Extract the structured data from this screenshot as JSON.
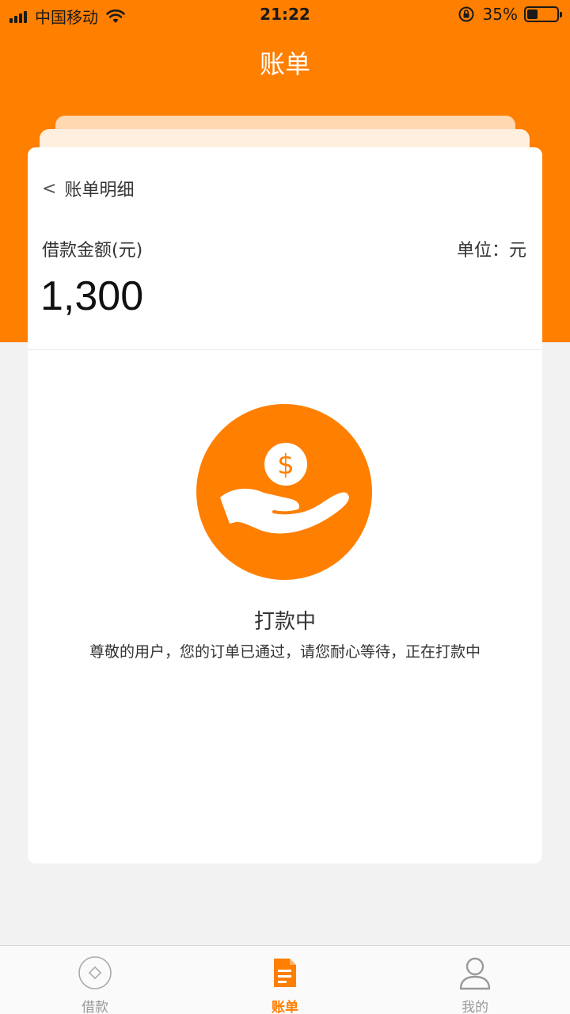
{
  "status_bar": {
    "carrier": "中国移动",
    "time": "21:22",
    "battery": "35%",
    "battery_level": 0.35
  },
  "header": {
    "title": "账单"
  },
  "card": {
    "back_label": "账单明细",
    "back_icon": "chevron-left-icon",
    "amount_label": "借款金额(元)",
    "unit_label": "单位：元",
    "amount_value": "1,300",
    "status_icon": "hand-coin-icon",
    "status_title": "打款中",
    "status_desc": "尊敬的用户，您的订单已通过，请您耐心等待，正在打款中"
  },
  "tabs": [
    {
      "label": "借款",
      "icon": "diamond-circle-icon",
      "active": false
    },
    {
      "label": "账单",
      "icon": "document-icon",
      "active": true
    },
    {
      "label": "我的",
      "icon": "user-icon",
      "active": false
    }
  ],
  "colors": {
    "accent": "#ff7f00",
    "background": "#f2f2f2",
    "card": "#ffffff",
    "tab_inactive": "#999999"
  }
}
